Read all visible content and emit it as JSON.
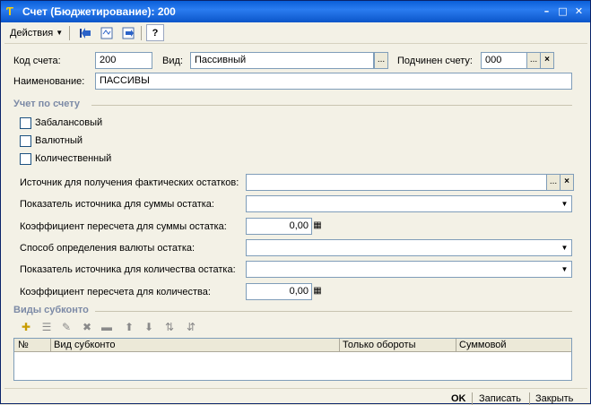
{
  "window": {
    "title": "Счет (Бюджетирование): 200",
    "app_icon": "1c-logo-icon",
    "controls": [
      "minimize-icon",
      "restore-icon",
      "close-icon"
    ]
  },
  "toolbar": {
    "actions_label": "Действия",
    "help_label": "?"
  },
  "form": {
    "code_label": "Код счета:",
    "code_value": "200",
    "type_label": "Вид:",
    "type_value": "Пассивный",
    "parent_label": "Подчинен счету:",
    "parent_value": "000",
    "name_label": "Наименование:",
    "name_value": "ПАССИВЫ",
    "ellipsis": "...",
    "clear": "×"
  },
  "accounting": {
    "section_title": "Учет по счету",
    "checkboxes": [
      {
        "label": "Забалансовый",
        "checked": false
      },
      {
        "label": "Валютный",
        "checked": false
      },
      {
        "label": "Количественный",
        "checked": false
      }
    ]
  },
  "params": {
    "fact_source_label": "Источник для получения фактических остатков:",
    "fact_source_value": "",
    "sum_source_label": "Показатель источника для суммы остатка:",
    "sum_source_value": "",
    "sum_coef_label": "Коэффициент пересчета для суммы остатка:",
    "sum_coef_value": "0,00",
    "currency_method_label": "Способ определения валюты остатка:",
    "currency_method_value": "",
    "qty_source_label": "Показатель источника для количества остатка:",
    "qty_source_value": "",
    "qty_coef_label": "Коэффициент пересчета для количества:",
    "qty_coef_value": "0,00"
  },
  "subconto": {
    "section_title": "Виды субконто",
    "columns": [
      "№",
      "Вид субконто",
      "Только обороты",
      "Суммовой"
    ],
    "rows": []
  },
  "footer": {
    "ok_label": "OK",
    "save_label": "Записать",
    "close_label": "Закрыть"
  }
}
